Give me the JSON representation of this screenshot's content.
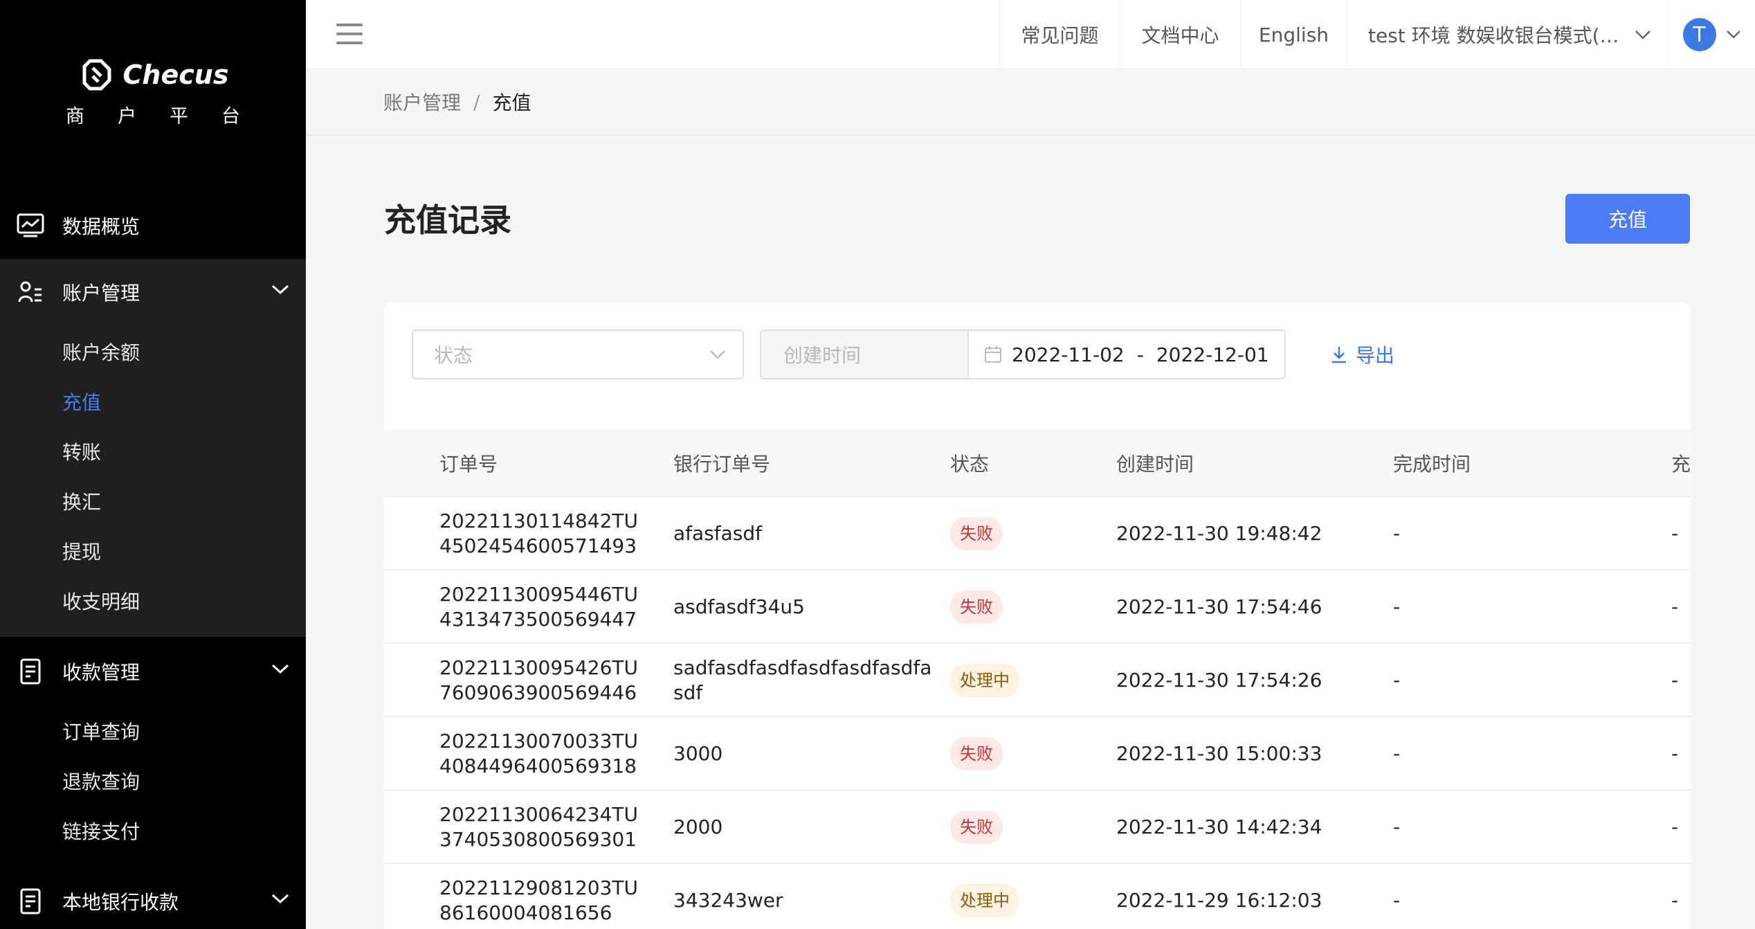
{
  "brand": {
    "name": "Checus",
    "subtitle": "商户平台"
  },
  "sidebar": {
    "overview": "数据概览",
    "account": {
      "label": "账户管理",
      "items": [
        "账户余额",
        "充值",
        "转账",
        "换汇",
        "提现",
        "收支明细"
      ]
    },
    "collection": {
      "label": "收款管理",
      "items": [
        "订单查询",
        "退款查询",
        "链接支付"
      ]
    },
    "local_bank": "本地银行收款"
  },
  "header": {
    "faq": "常见问题",
    "docs": "文档中心",
    "language": "English",
    "env": "test 环境 数娱收银台模式(…",
    "avatar_initial": "T"
  },
  "breadcrumb": {
    "parent": "账户管理",
    "current": "充值"
  },
  "page": {
    "title": "充值记录",
    "recharge_button": "充值"
  },
  "filters": {
    "status_placeholder": "状态",
    "created_time_label": "创建时间",
    "date_start": "2022-11-02",
    "date_sep": "-",
    "date_end": "2022-12-01",
    "export_label": "导出"
  },
  "table": {
    "columns": [
      "订单号",
      "银行订单号",
      "状态",
      "创建时间",
      "完成时间",
      "充"
    ],
    "rows": [
      {
        "order_no": "20221130114842TU4502454600571493",
        "bank_no": "afasfasdf",
        "status": "失败",
        "status_type": "fail",
        "created": "2022-11-30 19:48:42",
        "finished": "-",
        "extra": "-"
      },
      {
        "order_no": "20221130095446TU4313473500569447",
        "bank_no": "asdfasdf34u5",
        "status": "失败",
        "status_type": "fail",
        "created": "2022-11-30 17:54:46",
        "finished": "-",
        "extra": "-"
      },
      {
        "order_no": "20221130095426TU7609063900569446",
        "bank_no": "sadfasdfasdfasdfasdfasdfasdf",
        "status": "处理中",
        "status_type": "proc",
        "created": "2022-11-30 17:54:26",
        "finished": "-",
        "extra": "-"
      },
      {
        "order_no": "20221130070033TU4084496400569318",
        "bank_no": "3000",
        "status": "失败",
        "status_type": "fail",
        "created": "2022-11-30 15:00:33",
        "finished": "-",
        "extra": "-"
      },
      {
        "order_no": "20221130064234TU3740530800569301",
        "bank_no": "2000",
        "status": "失败",
        "status_type": "fail",
        "created": "2022-11-30 14:42:34",
        "finished": "-",
        "extra": "-"
      },
      {
        "order_no": "20221129081203TU86160004081656",
        "bank_no": "343243wer",
        "status": "处理中",
        "status_type": "proc",
        "created": "2022-11-29 16:12:03",
        "finished": "-",
        "extra": "-"
      }
    ]
  },
  "colors": {
    "accent": "#4a7df3",
    "sidebar_bg": "#000000",
    "fail_bg": "#fde8e8",
    "processing_bg": "#fdf2df"
  }
}
